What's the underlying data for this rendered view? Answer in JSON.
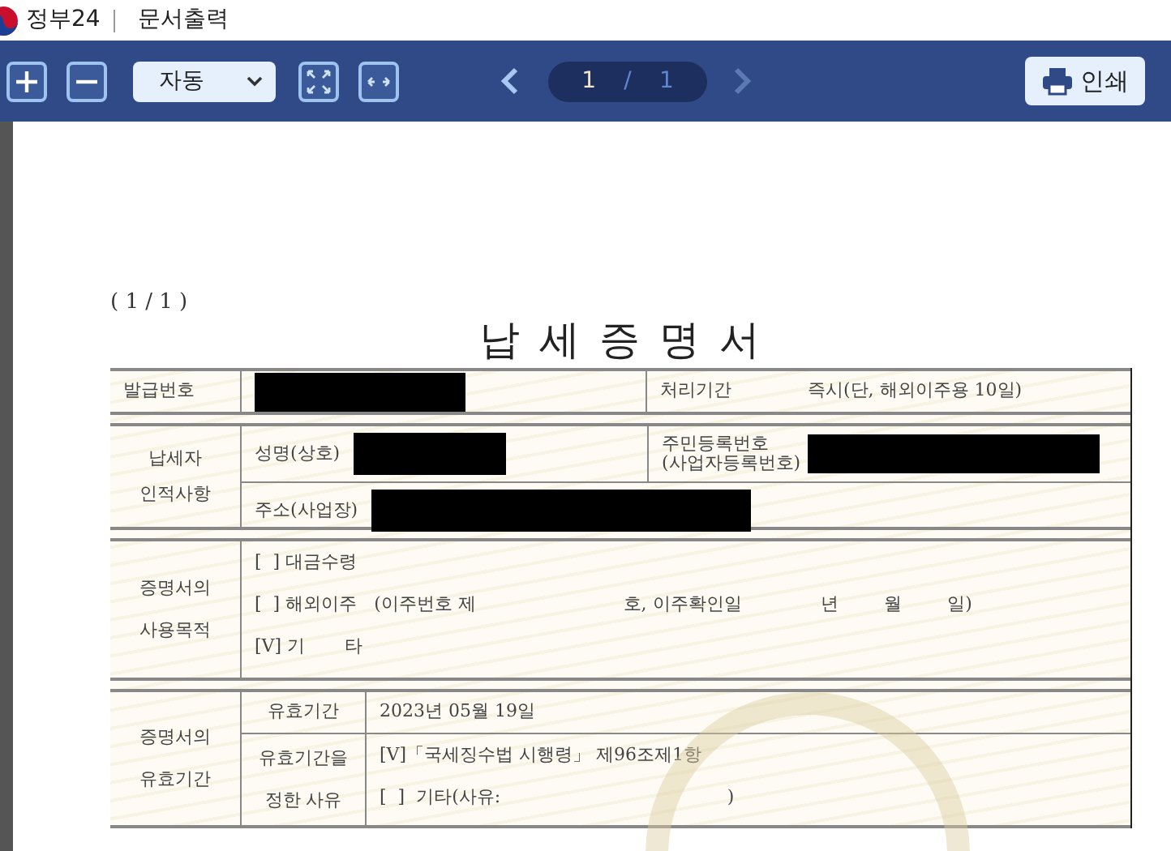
{
  "window": {
    "site": "정부24",
    "title": "문서출력"
  },
  "toolbar": {
    "zoom_select": {
      "value": "자동"
    },
    "page": {
      "current": "1",
      "separator": "/",
      "total": "1"
    },
    "prev_disabled": false,
    "next_disabled": true,
    "print_label": "인쇄"
  },
  "document": {
    "page_counter": "( 1 / 1 )",
    "title": "납 세 증 명 서",
    "issue_row": {
      "label": "발급번호",
      "process_label": "처리기간",
      "process_value": "즉시(단, 해외이주용 10일)"
    },
    "taxpayer": {
      "label_lines": [
        "납세자",
        "인적사항"
      ],
      "name_label": "성명(상호)",
      "id_label_lines": [
        "주민등록번호",
        "(사업자등록번호)"
      ],
      "address_label": "주소(사업장)"
    },
    "purpose": {
      "label_lines": [
        "증명서의",
        "사용목적"
      ],
      "options": [
        "[  ] 대금수령",
        "[  ] 해외이주   (이주번호 제                          호, 이주확인일              년        월        일)",
        "[V] 기       타"
      ]
    },
    "validity": {
      "label_lines": [
        "증명서의",
        "유효기간"
      ],
      "period_label": "유효기간",
      "period_value": "2023년 05월 19일",
      "reason_label_lines": [
        "유효기간을",
        "정한 사유"
      ],
      "reasons": [
        "[V]「국세징수법 시행령」 제96조제1항",
        "[  ]  기타(사유:                                        )"
      ]
    }
  }
}
